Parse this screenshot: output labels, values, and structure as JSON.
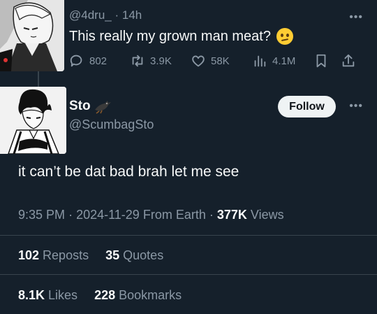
{
  "parent": {
    "handle": "@4dru_",
    "separator": "·",
    "time": "14h",
    "text": "This really my grown man meat?",
    "replies": "802",
    "reposts": "3.9K",
    "likes": "58K",
    "views": "4.1M"
  },
  "tweet": {
    "name": "Sto",
    "handle": "@ScumbagSto",
    "follow_label": "Follow",
    "text": "it can’t be dat bad brah let me see",
    "time": "9:35 PM",
    "date": "2024-11-29",
    "location": "From Earth",
    "views_count": "377K",
    "views_label": "Views"
  },
  "stats": {
    "reposts_count": "102",
    "reposts_label": "Reposts",
    "quotes_count": "35",
    "quotes_label": "Quotes",
    "likes_count": "8.1K",
    "likes_label": "Likes",
    "bookmarks_count": "228",
    "bookmarks_label": "Bookmarks"
  },
  "icons": {
    "reply": "reply-icon",
    "repost": "repost-icon",
    "like": "heart-icon",
    "views": "views-chart-icon",
    "bookmark": "bookmark-icon",
    "share": "share-icon",
    "more": "more-icon",
    "name_emoji": "crow-emoji-icon",
    "text_emoji": "confused-face-emoji-icon"
  },
  "colors": {
    "background": "#15202b",
    "text": "#f7f9f9",
    "muted": "#8b98a5",
    "divider": "#38444d",
    "follow_bg": "#eff3f4"
  }
}
